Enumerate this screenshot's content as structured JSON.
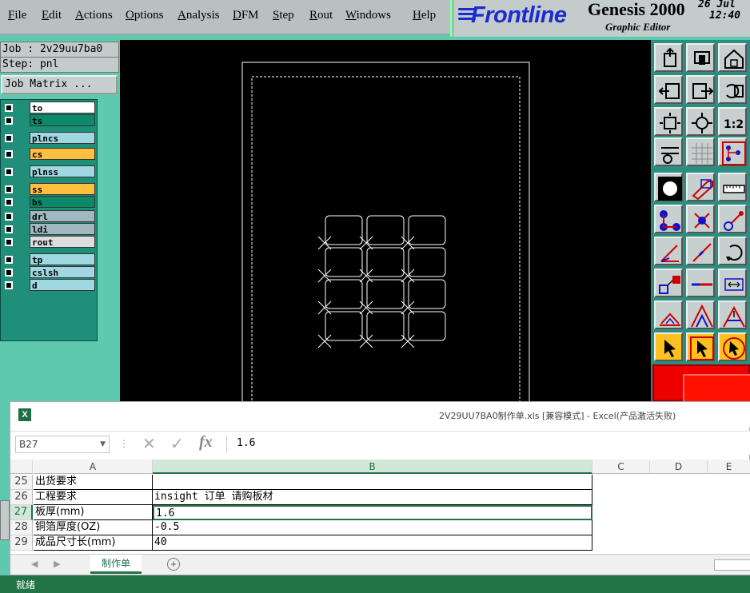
{
  "menubar": {
    "items": [
      "File",
      "Edit",
      "Actions",
      "Options",
      "Analysis",
      "DFM",
      "Step",
      "Rout",
      "Windows",
      "Help"
    ]
  },
  "brand": {
    "logo": "Frontline",
    "product": "Genesis 2000",
    "subtitle": "Graphic Editor",
    "date": "26 Jul",
    "time": "12:40"
  },
  "job": {
    "job_label": "Job : 2v29uu7ba0",
    "step_label": "Step: pnl",
    "matrix_button": "Job Matrix ..."
  },
  "layers": [
    {
      "name": "to",
      "color": "#ffffff"
    },
    {
      "name": "ts",
      "color": "#0b8a6a"
    },
    {
      "name": "plncs",
      "color": "#9fd8e0"
    },
    {
      "name": "cs",
      "color": "#ffc040"
    },
    {
      "name": "plnss",
      "color": "#9fd8e0"
    },
    {
      "name": "ss",
      "color": "#ffc040"
    },
    {
      "name": "bs",
      "color": "#0b8a6a"
    },
    {
      "name": "drl",
      "color": "#a0b8c0"
    },
    {
      "name": "ldi",
      "color": "#a0b8c0"
    },
    {
      "name": "rout",
      "color": "#dddddd"
    },
    {
      "name": "tp",
      "color": "#9fd8e0"
    },
    {
      "name": "cslsh",
      "color": "#9fd8e0"
    },
    {
      "name": "d",
      "color": "#9fd8e0"
    }
  ],
  "toolbar": {
    "icons": [
      "step-up-icon",
      "step-down-icon",
      "home-icon",
      "pan-left-icon",
      "pan-right-icon",
      "undo-zoom-icon",
      "zoom-fit-icon",
      "zoom-center-icon",
      "zoom-1-2-icon",
      "measure-settings-icon",
      "grid-icon",
      "snap-icon",
      "select-pad-icon",
      "select-shape-icon",
      "ruler-icon",
      "connect-icon",
      "cross-icon",
      "pin-icon",
      "line-angle-icon",
      "line-icon",
      "rotate-icon",
      "move-icon",
      "horizontal-line-icon",
      "spacing-icon",
      "arc-icon",
      "triangle-icon",
      "arch-icon",
      "pointer-icon",
      "pointer-box-icon",
      "pointer-clock-icon"
    ],
    "zoom_label": "1:2"
  },
  "excel": {
    "title": "2V29UU7BA0制作单.xls  [兼容模式] - Excel(产品激活失败)",
    "name_box": "B27",
    "formula_value": "1.6",
    "fx_label": "fx",
    "columns": [
      "A",
      "B",
      "C",
      "D",
      "E"
    ],
    "rows": [
      {
        "num": "25",
        "a": "出货要求",
        "b": ""
      },
      {
        "num": "26",
        "a": "工程要求",
        "b": "insight 订单 请购板材"
      },
      {
        "num": "27",
        "a": "板厚(mm)",
        "b": "1.6"
      },
      {
        "num": "28",
        "a": "铜箔厚度(OZ)",
        "b": "-0.5"
      },
      {
        "num": "29",
        "a": "成品尺寸长(mm)",
        "b": "40"
      }
    ],
    "active_row": "27",
    "sheet_tab": "制作单",
    "status": "就绪"
  },
  "colors": {
    "excel_green": "#217346",
    "genesis_bg": "#5fc9b0",
    "canvas": "#000000"
  }
}
